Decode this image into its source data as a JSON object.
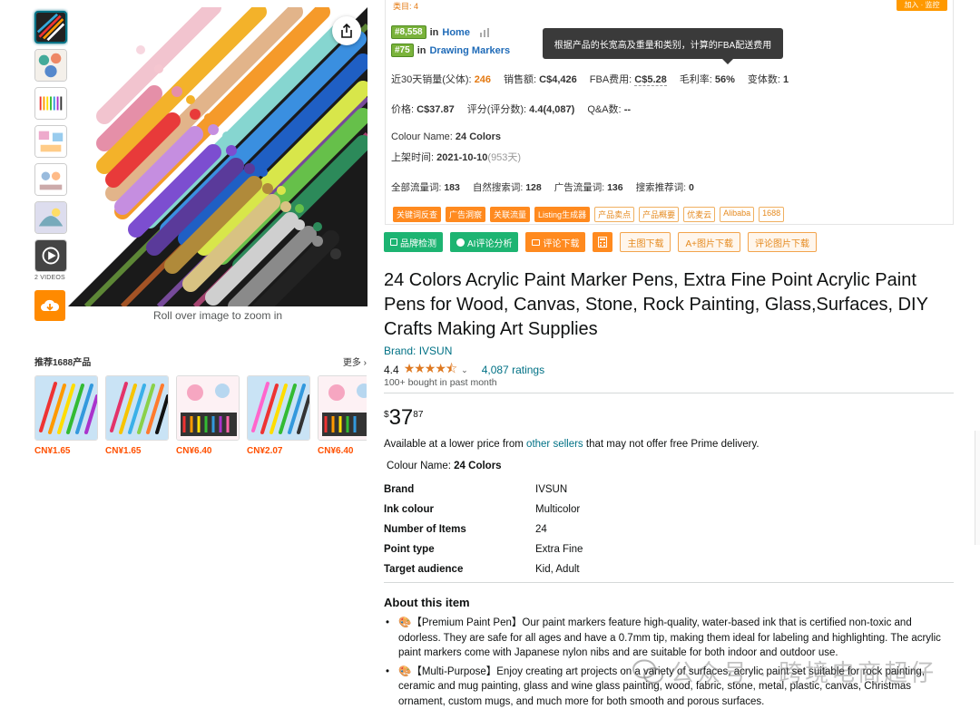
{
  "thumbnails": {
    "videos_label": "2 VIDEOS"
  },
  "main_image": {
    "zoom_hint": "Roll over image to zoom in"
  },
  "recommend": {
    "title": "推荐1688产品",
    "more": "更多",
    "items": [
      {
        "price": "CN¥1.65"
      },
      {
        "price": "CN¥1.65"
      },
      {
        "price": "CN¥6.40"
      },
      {
        "price": "CN¥2.07"
      },
      {
        "price": "CN¥6.40"
      }
    ]
  },
  "panel": {
    "top_left": "类目: 4",
    "top_right": "加入 · 监控",
    "ranks": [
      {
        "badge": "#8,558",
        "in": "in",
        "category": "Home"
      },
      {
        "badge": "#75",
        "in": "in",
        "category": "Drawing Markers"
      }
    ],
    "tooltip": "根据产品的长宽高及重量和类别，计算的FBA配送费用",
    "stats1": {
      "sales_label": "近30天销量(父体):",
      "sales": "246",
      "revenue_label": "销售额:",
      "revenue": "C$4,426",
      "fba_label": "FBA费用:",
      "fba": "C$5.28",
      "margin_label": "毛利率:",
      "margin": "56%",
      "variants_label": "变体数:",
      "variants": "1"
    },
    "stats2": {
      "price_label": "价格:",
      "price": "C$37.87",
      "rating_label": "评分(评分数):",
      "rating": "4.4(4,087)",
      "qa_label": "Q&A数:",
      "qa": "--"
    },
    "colour_label": "Colour Name:",
    "colour": "24 Colors",
    "launch_label": "上架时间:",
    "launch_date": "2021-10-10",
    "launch_days": "(953天)",
    "stats3": {
      "total_kw_label": "全部流量词:",
      "total_kw": "183",
      "organic_kw_label": "自然搜索词:",
      "organic_kw": "128",
      "ad_kw_label": "广告流量词:",
      "ad_kw": "136",
      "rec_kw_label": "搜索推荐词:",
      "rec_kw": "0"
    },
    "tags": [
      {
        "label": "关键词反查",
        "solid": true
      },
      {
        "label": "广告洞察",
        "solid": true
      },
      {
        "label": "关联流量",
        "solid": true
      },
      {
        "label": "Listing生成器",
        "solid": true
      },
      {
        "label": "产品卖点",
        "solid": false
      },
      {
        "label": "产品概要",
        "solid": false
      },
      {
        "label": "优麦云",
        "solid": false
      },
      {
        "label": "Alibaba",
        "solid": false
      },
      {
        "label": "1688",
        "solid": false
      }
    ]
  },
  "actions": {
    "brand_check": "品牌检测",
    "ai_review": "AI评论分析",
    "review_download": "评论下载",
    "main_download": "主图下载",
    "aplus_download": "A+图片下载",
    "review_img_download": "评论图片下载"
  },
  "product": {
    "title": "24 Colors Acrylic Paint Marker Pens, Extra Fine Point Acrylic Paint Pens for Wood, Canvas, Stone, Rock Painting, Glass,Surfaces, DIY Crafts Making Art Supplies",
    "brand_link": "Brand: IVSUN",
    "rating_value": "4.4",
    "stars": "★★★★⯪",
    "ratings_count": "4,087 ratings",
    "bought": "100+ bought in past month",
    "price_symbol": "$",
    "price_whole": "37",
    "price_fraction": "87",
    "avail_prefix": "Available at a lower price from",
    "avail_link": "other sellers",
    "avail_suffix": "that may not offer free Prime delivery.",
    "colour_label": "Colour Name:",
    "colour_value": "24 Colors",
    "specs": [
      {
        "key": "Brand",
        "value": "IVSUN"
      },
      {
        "key": "Ink colour",
        "value": "Multicolor"
      },
      {
        "key": "Number of Items",
        "value": "24"
      },
      {
        "key": "Point type",
        "value": "Extra Fine"
      },
      {
        "key": "Target audience",
        "value": "Kid, Adult"
      }
    ],
    "about_title": "About this item",
    "bullets": [
      "🎨【Premium Paint Pen】Our paint markers feature high-quality, water-based ink that is certified non-toxic and odorless. They are safe for all ages and have a 0.7mm tip, making them ideal for labeling and highlighting. The acrylic paint markers come with Japanese nylon nibs and are suitable for both indoor and outdoor use.",
      "🎨【Multi-Purpose】Enjoy creating art projects on a variety of surfaces, acrylic paint set suitable for rock painting, ceramic and mug painting, glass and wine glass painting, wood, fabric, stone, metal, plastic, canvas, Christmas ornament, custom mugs, and much more for both smooth and porous surfaces."
    ]
  },
  "watermark": "公众号 · 跨境电商超仔"
}
